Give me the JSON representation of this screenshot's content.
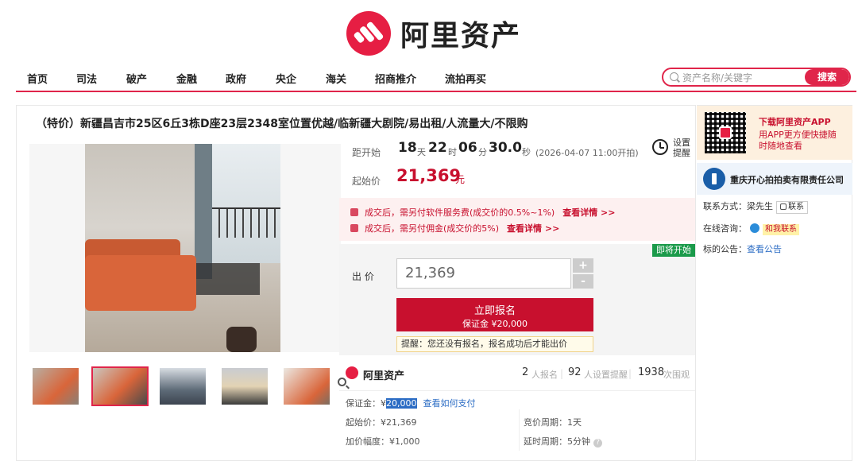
{
  "brand": {
    "name": "阿里资产",
    "accent": "#e61e43"
  },
  "nav": {
    "items": [
      "首页",
      "司法",
      "破产",
      "金融",
      "政府",
      "央企",
      "海关",
      "招商推介",
      "流拍再买"
    ]
  },
  "search": {
    "placeholder": "资产名称/关键字",
    "button": "搜索"
  },
  "listing": {
    "title": "（特价）新疆昌吉市25区6丘3栋D座23层2348室位置优越/临新疆大剧院/易出租/人流量大/不限购"
  },
  "countdown": {
    "label": "距开始",
    "days": "18",
    "days_unit": "天",
    "hours": "22",
    "hours_unit": "时",
    "minutes": "06",
    "minutes_unit": "分",
    "seconds": "30.0",
    "seconds_unit": "秒",
    "start_date": "(2026-04-07 11:00开拍)",
    "reminder": "设置提醒"
  },
  "start_price": {
    "label": "起始价",
    "value": "21,369",
    "unit": "元"
  },
  "fees": [
    {
      "text": "成交后，需另付软件服务费(成交价的0.5%~1%)",
      "link": "查看详情 >>"
    },
    {
      "text": "成交后，需另付佣金(成交价的5%)",
      "link": "查看详情 >>"
    }
  ],
  "bid": {
    "badge": "即将开始",
    "label": "出  价",
    "value": "21,369",
    "plus": "+",
    "minus": "-",
    "signup_main": "立即报名",
    "signup_sub": "保证金 ¥20,000",
    "hint": "提醒：您还没有报名，报名成功后才能出价"
  },
  "stats": {
    "brand": "阿里资产",
    "signups": "2",
    "signups_label": "人报名",
    "reminders": "92",
    "reminders_label": "人设置提醒",
    "views": "1938",
    "views_label": "次围观"
  },
  "details": {
    "deposit_label": "保证金：¥",
    "deposit_value": "20,000",
    "pay_link": "查看如何支付",
    "start_price": "起始价：¥21,369",
    "bid_period": "竞价周期：1天",
    "increment": "加价幅度：¥1,000",
    "extension": "延时周期：5分钟"
  },
  "side": {
    "app_title": "下载阿里资产APP",
    "app_desc": "用APP更方便快捷随时随地查看",
    "seller": "重庆开心拍拍卖有限责任公司",
    "contact_label": "联系方式：",
    "contact_name": "梁先生",
    "contact_btn": "联系",
    "consult_label": "在线咨询：",
    "consult_btn": "和我联系",
    "notice_label": "标的公告：",
    "notice_link": "查看公告"
  }
}
